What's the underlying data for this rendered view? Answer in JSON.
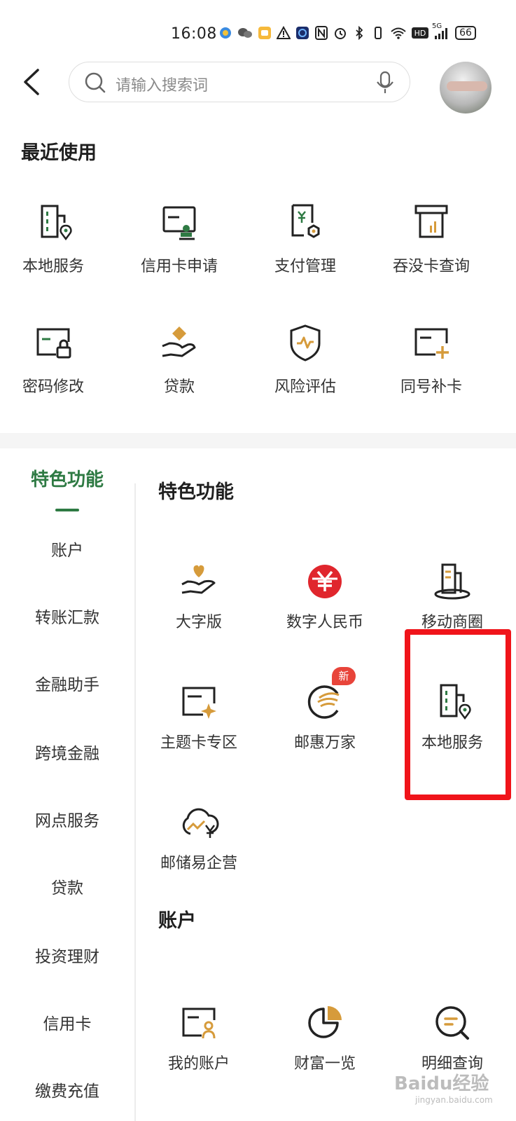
{
  "status_bar": {
    "time": "16:08",
    "network": "5G",
    "hd": "HD",
    "battery": "66"
  },
  "header": {
    "search_placeholder": "请输入搜索词"
  },
  "recent": {
    "title": "最近使用",
    "items": [
      {
        "label": "本地服务",
        "icon": "local-service-icon"
      },
      {
        "label": "信用卡申请",
        "icon": "credit-card-apply-icon"
      },
      {
        "label": "支付管理",
        "icon": "payment-management-icon"
      },
      {
        "label": "吞没卡查询",
        "icon": "swallowed-card-query-icon"
      },
      {
        "label": "密码修改",
        "icon": "password-change-icon"
      },
      {
        "label": "贷款",
        "icon": "loan-icon"
      },
      {
        "label": "风险评估",
        "icon": "risk-assessment-icon"
      },
      {
        "label": "同号补卡",
        "icon": "card-reissue-icon"
      }
    ]
  },
  "nav": {
    "items": [
      "特色功能",
      "账户",
      "转账汇款",
      "金融助手",
      "跨境金融",
      "网点服务",
      "贷款",
      "投资理财",
      "信用卡",
      "缴费充值"
    ],
    "active": "特色功能"
  },
  "featured": {
    "title": "特色功能",
    "items": [
      {
        "label": "大字版",
        "icon": "large-font-icon"
      },
      {
        "label": "数字人民币",
        "icon": "digital-rmb-icon"
      },
      {
        "label": "移动商圈",
        "icon": "mobile-mall-icon"
      },
      {
        "label": "主题卡专区",
        "icon": "theme-card-icon"
      },
      {
        "label": "邮惠万家",
        "icon": "youhui-wanjia-icon",
        "badge": "新"
      },
      {
        "label": "本地服务",
        "icon": "local-service-icon"
      },
      {
        "label": "邮储易企营",
        "icon": "yiqiying-icon"
      }
    ]
  },
  "account": {
    "title": "账户",
    "items": [
      {
        "label": "我的账户",
        "icon": "my-account-icon"
      },
      {
        "label": "财富一览",
        "icon": "wealth-overview-icon"
      },
      {
        "label": "明细查询",
        "icon": "detail-query-icon"
      }
    ]
  },
  "colors": {
    "accent_green": "#2e7a43",
    "gold": "#d69b3b",
    "highlight_red": "#f0141a",
    "badge_red": "#e8443a"
  },
  "watermark": {
    "brand": "Baidu经验",
    "url": "jingyan.baidu.com"
  }
}
